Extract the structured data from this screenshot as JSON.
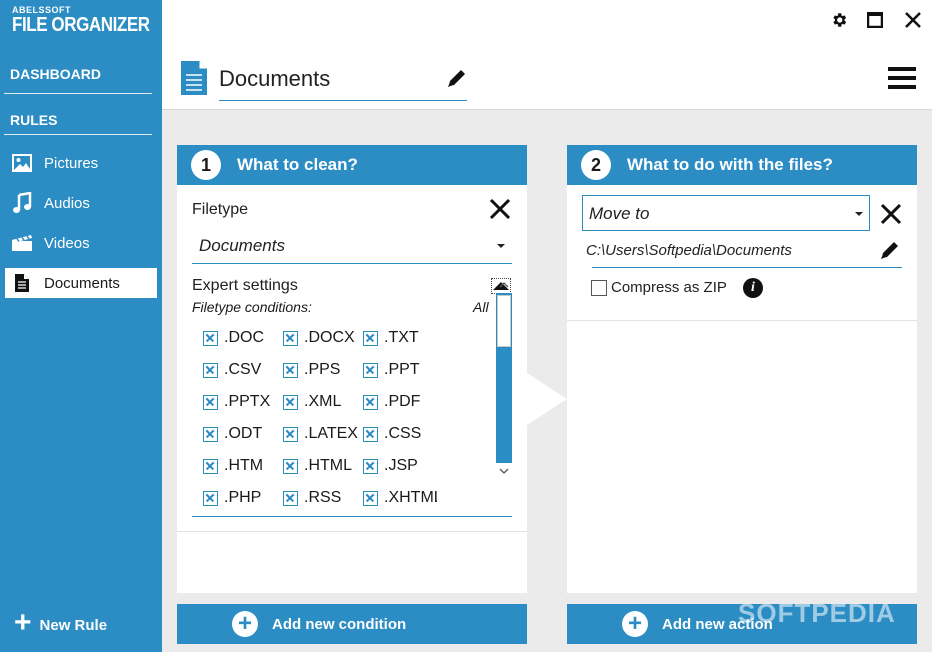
{
  "app": {
    "brand": "ABELSSOFT",
    "product": "FILE ORGANIZER"
  },
  "sidebar": {
    "dashboard_label": "DASHBOARD",
    "rules_label": "RULES",
    "items": [
      {
        "label": "Pictures",
        "icon": "image-icon"
      },
      {
        "label": "Audios",
        "icon": "music-note-icon"
      },
      {
        "label": "Videos",
        "icon": "clapperboard-icon"
      },
      {
        "label": "Documents",
        "icon": "document-icon",
        "active": true
      }
    ],
    "new_rule_label": "New Rule"
  },
  "header": {
    "title": "Documents"
  },
  "clean_panel": {
    "step": "1",
    "title": "What to clean?",
    "filetype_label": "Filetype",
    "filetype_value": "Documents",
    "expert_label": "Expert settings",
    "conditions_label": "Filetype conditions:",
    "all_label": "All",
    "extensions": [
      ".DOC",
      ".DOCX",
      ".TXT",
      ".CSV",
      ".PPS",
      ".PPT",
      ".PPTX",
      ".XML",
      ".PDF",
      ".ODT",
      ".LATEX",
      ".CSS",
      ".HTM",
      ".HTML",
      ".JSP",
      ".PHP",
      ".RSS",
      ".XHTML"
    ],
    "add_label": "Add new condition"
  },
  "action_panel": {
    "step": "2",
    "title": "What to do with the files?",
    "action_value": "Move to",
    "path": "C:\\Users\\Softpedia\\Documents",
    "compress_label": "Compress as ZIP",
    "add_label": "Add new action"
  },
  "watermark": "SOFTPEDIA",
  "colors": {
    "accent": "#2b8dc3",
    "background": "#ebebeb"
  }
}
